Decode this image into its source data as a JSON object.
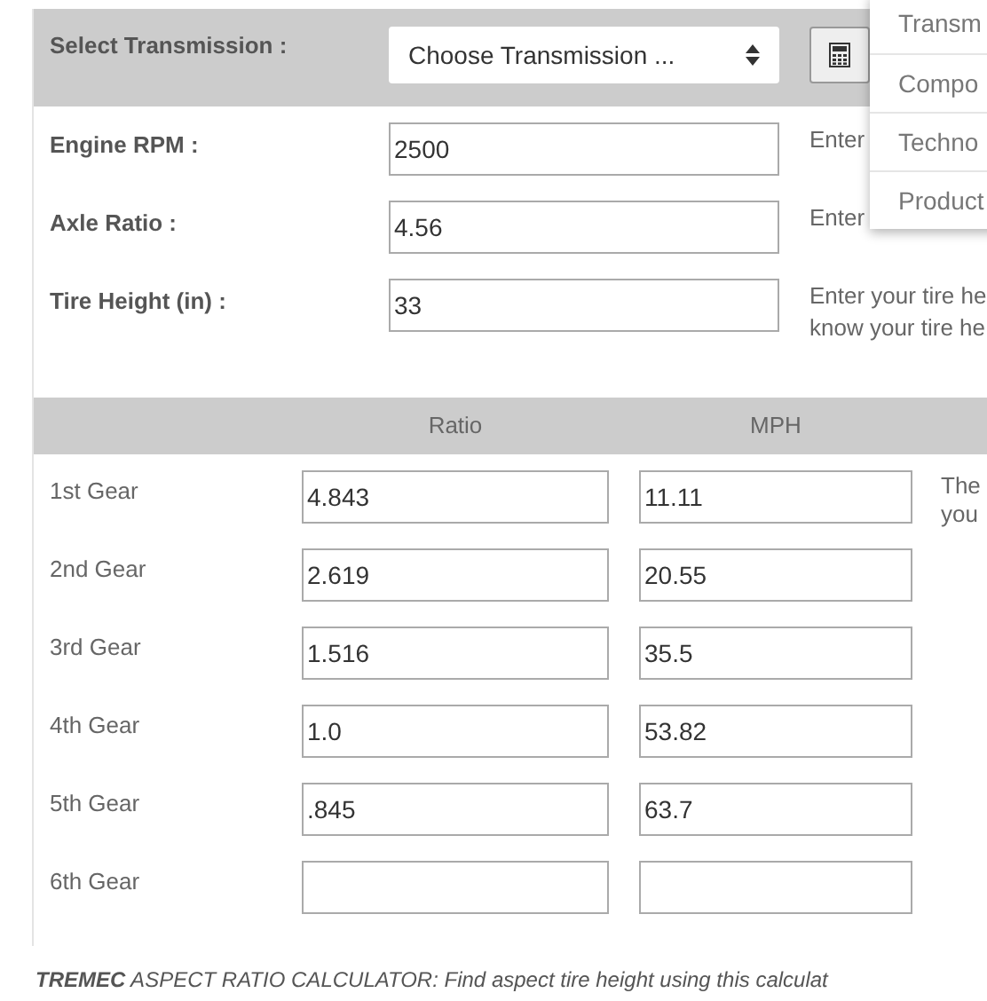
{
  "transmission": {
    "label": "Select Transmission :",
    "select": "Choose Transmission ..."
  },
  "fields": [
    {
      "label": "Engine RPM :",
      "value": "2500",
      "hint": [
        "Enter"
      ]
    },
    {
      "label": "Axle Ratio :",
      "value": "4.56",
      "hint": [
        "Enter"
      ]
    },
    {
      "label": "Tire Height (in) :",
      "value": "33",
      "hint": [
        "Enter your tire he",
        "know your tire he"
      ]
    }
  ],
  "gear_table": {
    "columns": [
      "Ratio",
      "MPH"
    ],
    "rows": [
      {
        "gear": "1st Gear",
        "ratio": "4.843",
        "mph": "11.11",
        "note": [
          "The",
          "you"
        ]
      },
      {
        "gear": "2nd Gear",
        "ratio": "2.619",
        "mph": "20.55"
      },
      {
        "gear": "3rd Gear",
        "ratio": "1.516",
        "mph": "35.5"
      },
      {
        "gear": "4th Gear",
        "ratio": "1.0",
        "mph": "53.82"
      },
      {
        "gear": "5th Gear",
        "ratio": ".845",
        "mph": "63.7"
      },
      {
        "gear": "6th Gear"
      }
    ]
  },
  "menu": [
    "Transm",
    "Compo",
    "Techno",
    "Product"
  ],
  "footer": "**TREMEC** ASPECT RATIO CALCULATOR: Find aspect tire height using this calculat"
}
